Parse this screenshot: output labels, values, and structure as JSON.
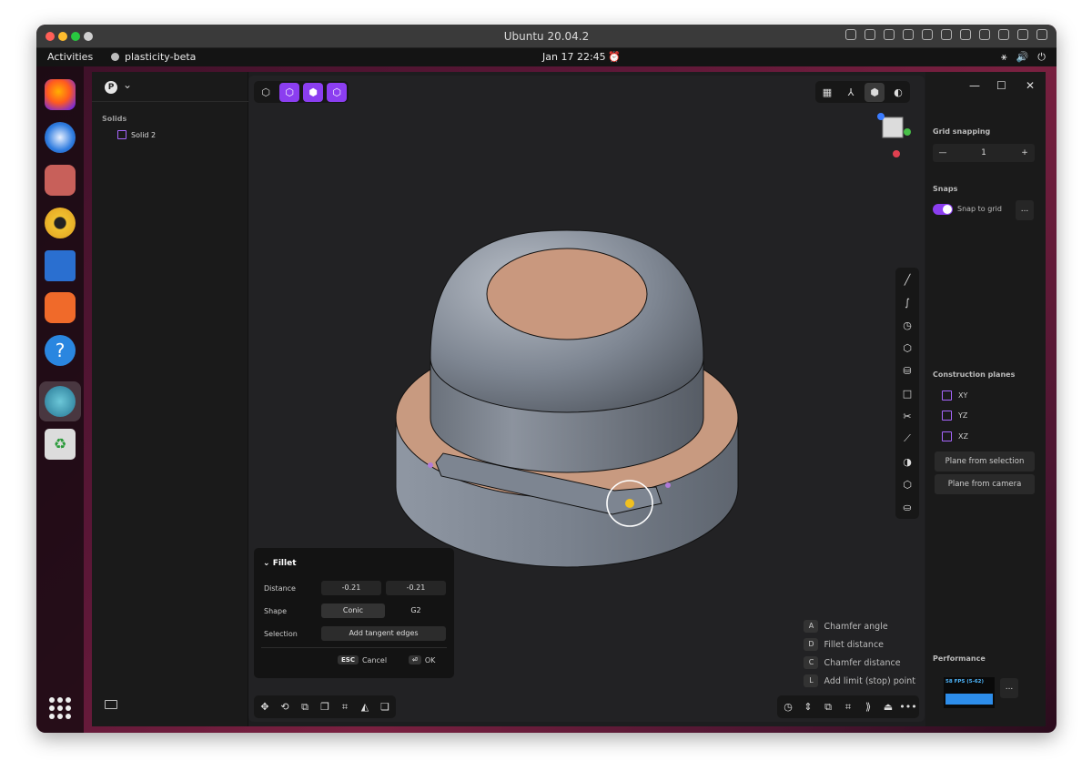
{
  "window_title": "Ubuntu 20.04.2",
  "topbar": {
    "activities": "Activities",
    "app_name": "plasticity-beta",
    "clock": "Jan 17  22:45"
  },
  "left_panel": {
    "project_badge": "P",
    "section": "Solids",
    "items": [
      "Solid 2"
    ]
  },
  "fillet": {
    "title": "Fillet",
    "distance_label": "Distance",
    "distance_1": "-0.21",
    "distance_2": "-0.21",
    "shape_label": "Shape",
    "shape_1": "Conic",
    "shape_2": "G2",
    "selection_label": "Selection",
    "selection_value": "Add tangent edges",
    "cancel_key": "ESC",
    "cancel_label": "Cancel",
    "ok_key": "⏎",
    "ok_label": "OK"
  },
  "hints": [
    {
      "key": "A",
      "label": "Chamfer angle"
    },
    {
      "key": "D",
      "label": "Fillet distance"
    },
    {
      "key": "C",
      "label": "Chamfer distance"
    },
    {
      "key": "L",
      "label": "Add limit (stop) point"
    }
  ],
  "right_panel": {
    "grid_snapping": "Grid snapping",
    "grid_value": "1",
    "snaps": "Snaps",
    "snap_to_grid": "Snap to grid",
    "construction_planes": "Construction planes",
    "planes": [
      "XY",
      "YZ",
      "XZ"
    ],
    "plane_from_selection": "Plane from selection",
    "plane_from_camera": "Plane from camera",
    "performance": "Performance",
    "fps": "58 FPS (5-62)"
  },
  "colors": {
    "accent": "#8b3ef0",
    "viewport": "#222224",
    "panel": "#1a1a1a"
  }
}
